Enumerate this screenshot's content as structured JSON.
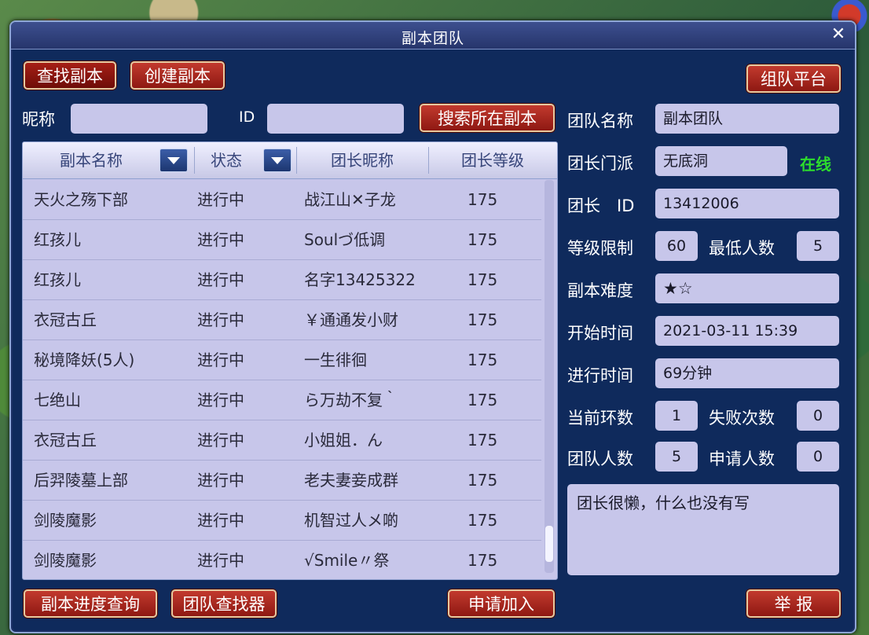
{
  "window": {
    "title": "副本团队",
    "close": "✕"
  },
  "top_buttons": {
    "find": "查找副本",
    "create": "创建副本",
    "platform": "组队平台"
  },
  "search": {
    "nickname_label": "昵称",
    "id_label": "ID",
    "nickname_value": "",
    "id_value": "",
    "search_button": "搜索所在副本"
  },
  "table": {
    "headers": [
      "副本名称",
      "状态",
      "团长昵称",
      "团长等级"
    ],
    "rows": [
      {
        "name": "天火之殇下部",
        "status": "进行中",
        "leader": "战江山✕子龙",
        "level": "175"
      },
      {
        "name": "红孩儿",
        "status": "进行中",
        "leader": "Soulづ低调",
        "level": "175"
      },
      {
        "name": "红孩儿",
        "status": "进行中",
        "leader": "名字13425322",
        "level": "175"
      },
      {
        "name": "衣冠古丘",
        "status": "进行中",
        "leader": "￥通通发小财",
        "level": "175"
      },
      {
        "name": "秘境降妖(5人)",
        "status": "进行中",
        "leader": "一生徘徊",
        "level": "175"
      },
      {
        "name": "七绝山",
        "status": "进行中",
        "leader": "ら万劫不复｀",
        "level": "175"
      },
      {
        "name": "衣冠古丘",
        "status": "进行中",
        "leader": "小姐姐．ん",
        "level": "175"
      },
      {
        "name": "后羿陵墓上部",
        "status": "进行中",
        "leader": "老夫妻妾成群",
        "level": "175"
      },
      {
        "name": "剑陵魔影",
        "status": "进行中",
        "leader": "机智过人メ啲",
        "level": "175"
      },
      {
        "name": "剑陵魔影",
        "status": "进行中",
        "leader": "√Smile〃祭",
        "level": "175"
      }
    ]
  },
  "details": {
    "team_name_label": "团队名称",
    "team_name": "副本团队",
    "school_label": "团长门派",
    "school": "无底洞",
    "online": "在线",
    "leader_id_label": "团长　ID",
    "leader_id": "13412006",
    "level_limit_label": "等级限制",
    "level_limit": "60",
    "min_people_label": "最低人数",
    "min_people": "5",
    "difficulty_label": "副本难度",
    "difficulty": "★☆",
    "start_label": "开始时间",
    "start": "2021-03-11 15:39",
    "elapsed_label": "进行时间",
    "elapsed": "69分钟",
    "round_label": "当前环数",
    "round": "1",
    "fail_label": "失败次数",
    "fail": "0",
    "members_label": "团队人数",
    "members": "5",
    "applicants_label": "申请人数",
    "applicants": "0",
    "description": "团长很懒，什么也没有写"
  },
  "bottom_buttons": {
    "progress": "副本进度查询",
    "finder": "团队查找器",
    "apply": "申请加入",
    "report": "举 报"
  }
}
